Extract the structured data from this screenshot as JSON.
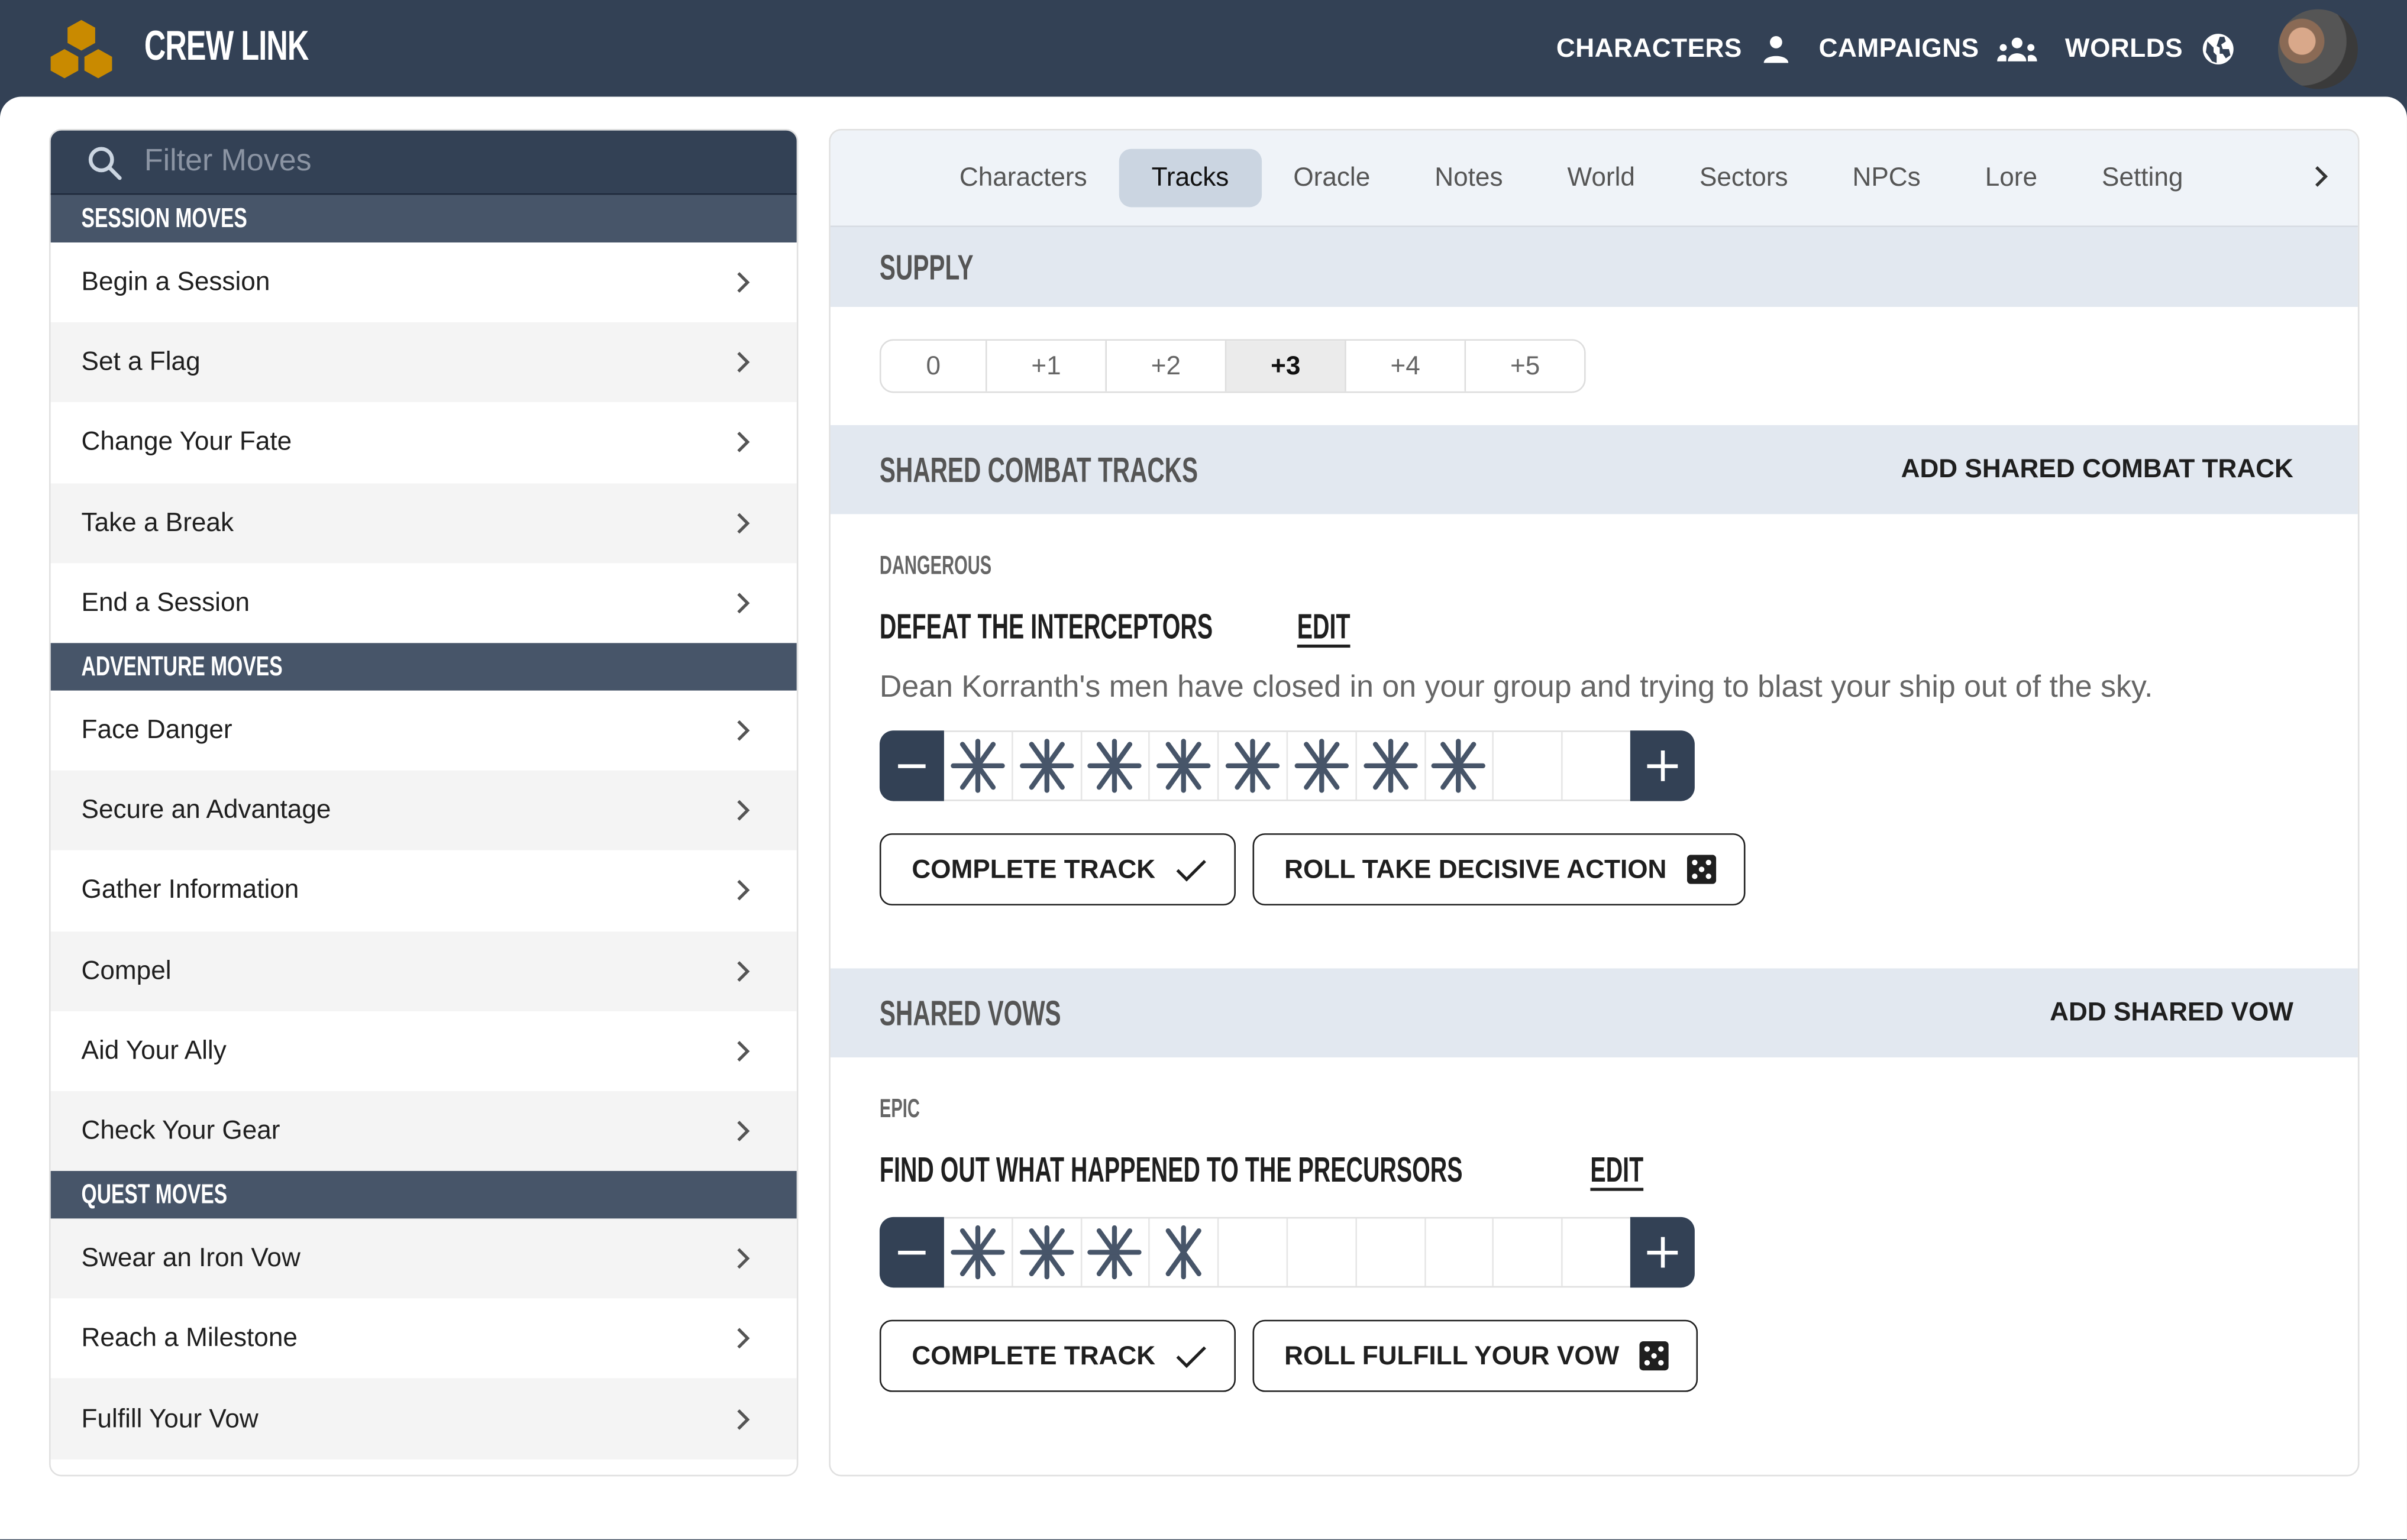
{
  "header": {
    "brand": "CREW LINK",
    "logo_color": "#c98a00",
    "nav": [
      {
        "label": "CHARACTERS",
        "icon": "person-icon"
      },
      {
        "label": "CAMPAIGNS",
        "icon": "group-icon"
      },
      {
        "label": "WORLDS",
        "icon": "globe-icon"
      }
    ],
    "avatar_alt": "user-avatar"
  },
  "sidebar": {
    "search_placeholder": "Filter Moves",
    "categories": [
      {
        "title": "SESSION MOVES",
        "moves": [
          "Begin a Session",
          "Set a Flag",
          "Change Your Fate",
          "Take a Break",
          "End a Session"
        ]
      },
      {
        "title": "ADVENTURE MOVES",
        "moves": [
          "Face Danger",
          "Secure an Advantage",
          "Gather Information",
          "Compel",
          "Aid Your Ally",
          "Check Your Gear"
        ]
      },
      {
        "title": "QUEST MOVES",
        "moves": [
          "Swear an Iron Vow",
          "Reach a Milestone",
          "Fulfill Your Vow"
        ]
      }
    ]
  },
  "tabs": {
    "items": [
      "Characters",
      "Tracks",
      "Oracle",
      "Notes",
      "World",
      "Sectors",
      "NPCs",
      "Lore",
      "Setting"
    ],
    "active": "Tracks"
  },
  "supply": {
    "title": "SUPPLY",
    "options": [
      "0",
      "+1",
      "+2",
      "+3",
      "+4",
      "+5"
    ],
    "selected": "+3"
  },
  "combat": {
    "title": "SHARED COMBAT TRACKS",
    "action": "ADD SHARED COMBAT TRACK",
    "tracks": [
      {
        "rank": "DANGEROUS",
        "name": "DEFEAT THE INTERCEPTORS",
        "edit_label": "EDIT",
        "description": "Dean Korranth's men have closed in on your group and trying to blast your ship out of the sky.",
        "progress_ticks": 32,
        "max_ticks": 40,
        "complete_label": "COMPLETE TRACK",
        "roll_label": "ROLL TAKE DECISIVE ACTION"
      }
    ]
  },
  "vows": {
    "title": "SHARED VOWS",
    "action": "ADD SHARED VOW",
    "tracks": [
      {
        "rank": "EPIC",
        "name": "FIND OUT WHAT HAPPENED TO THE PRECURSORS",
        "edit_label": "EDIT",
        "progress_ticks": 15,
        "max_ticks": 40,
        "complete_label": "COMPLETE TRACK",
        "roll_label": "ROLL FULFILL YOUR VOW"
      }
    ]
  },
  "colors": {
    "primary": "#334155",
    "category": "#475569",
    "section_bg": "#e2e8f0",
    "tick": "#475569"
  }
}
